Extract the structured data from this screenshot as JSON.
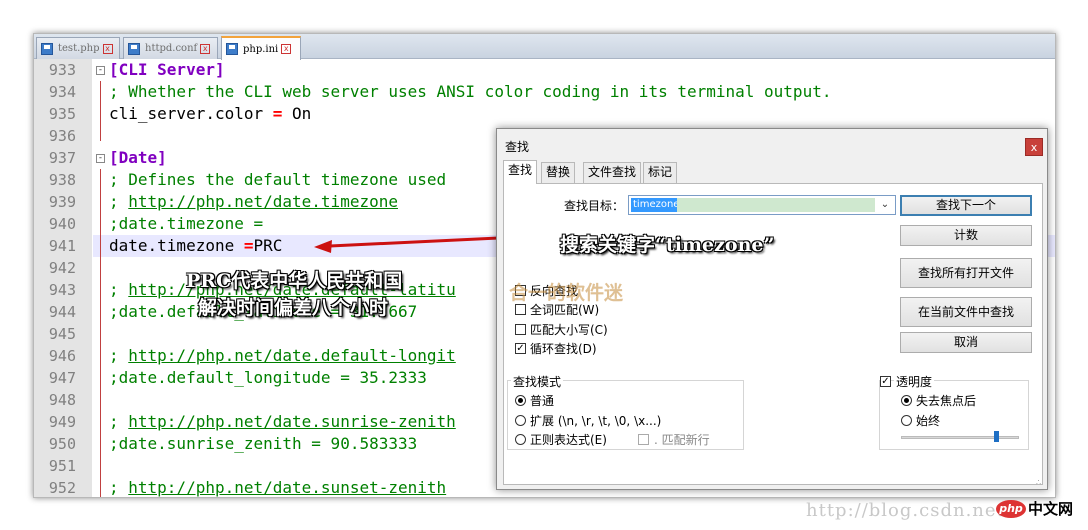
{
  "tabs": [
    {
      "label": "test.php",
      "active": false
    },
    {
      "label": "httpd.conf",
      "active": false
    },
    {
      "label": "php.ini",
      "active": true
    }
  ],
  "editor": {
    "lines": [
      {
        "num": "933",
        "parts": [
          {
            "t": "[CLI Server]",
            "c": "section"
          }
        ]
      },
      {
        "num": "934",
        "parts": [
          {
            "t": "; Whether the CLI web server uses ANSI color coding in its terminal output.",
            "c": "comment"
          }
        ]
      },
      {
        "num": "935",
        "parts": [
          {
            "t": "cli_server.color ",
            "c": "plain"
          },
          {
            "t": "=",
            "c": "op"
          },
          {
            "t": " On",
            "c": "plain"
          }
        ]
      },
      {
        "num": "936",
        "parts": []
      },
      {
        "num": "937",
        "parts": [
          {
            "t": "[Date]",
            "c": "section"
          }
        ]
      },
      {
        "num": "938",
        "parts": [
          {
            "t": "; Defines the default timezone used",
            "c": "comment"
          }
        ]
      },
      {
        "num": "939",
        "parts": [
          {
            "t": "; ",
            "c": "comment"
          },
          {
            "t": "http://php.net/date.timezone",
            "c": "link"
          }
        ]
      },
      {
        "num": "940",
        "parts": [
          {
            "t": ";date.timezone =",
            "c": "comment"
          }
        ]
      },
      {
        "num": "941",
        "parts": [
          {
            "t": "date.timezone ",
            "c": "plain"
          },
          {
            "t": "=",
            "c": "op"
          },
          {
            "t": "PRC",
            "c": "plain"
          }
        ]
      },
      {
        "num": "942",
        "parts": []
      },
      {
        "num": "943",
        "parts": [
          {
            "t": "; ",
            "c": "comment"
          },
          {
            "t": "http://php.net/date.default-latitu",
            "c": "link"
          }
        ]
      },
      {
        "num": "944",
        "parts": [
          {
            "t": ";date.default_latitude = 31.7667",
            "c": "comment"
          }
        ]
      },
      {
        "num": "945",
        "parts": []
      },
      {
        "num": "946",
        "parts": [
          {
            "t": "; ",
            "c": "comment"
          },
          {
            "t": "http://php.net/date.default-longit",
            "c": "link"
          }
        ]
      },
      {
        "num": "947",
        "parts": [
          {
            "t": ";date.default_longitude = 35.2333",
            "c": "comment"
          }
        ]
      },
      {
        "num": "948",
        "parts": []
      },
      {
        "num": "949",
        "parts": [
          {
            "t": "; ",
            "c": "comment"
          },
          {
            "t": "http://php.net/date.sunrise-zenith",
            "c": "link"
          }
        ]
      },
      {
        "num": "950",
        "parts": [
          {
            "t": ";date.sunrise_zenith = 90.583333",
            "c": "comment"
          }
        ]
      },
      {
        "num": "951",
        "parts": []
      },
      {
        "num": "952",
        "parts": [
          {
            "t": "; ",
            "c": "comment"
          },
          {
            "t": "http://php.net/date.sunset-zenith",
            "c": "link"
          }
        ]
      }
    ],
    "fold_markers": [
      "933",
      "937"
    ]
  },
  "annotations": {
    "keyword": "搜索关键字“timezone”",
    "prc_line1": "PRC代表中华人民共和国",
    "prc_line2": "解决时间偏差八个小时"
  },
  "find_dialog": {
    "title": "查找",
    "close_icon": "close-icon",
    "tabs": [
      "查找",
      "替换",
      "文件查找",
      "标记"
    ],
    "active_tab": "查找",
    "target_label": "查找目标：",
    "target_value": "timezone",
    "buttons": {
      "find_next": "查找下一个",
      "count": "计数",
      "find_all_open": "查找所有打开文件",
      "find_in_current": "在当前文件中查找",
      "cancel": "取消"
    },
    "options": [
      {
        "label": "反向查找",
        "checked": false
      },
      {
        "label": "全词匹配(W)",
        "checked": false
      },
      {
        "label": "匹配大小写(C)",
        "checked": false
      },
      {
        "label": "循环查找(D)",
        "checked": true
      }
    ],
    "search_mode": {
      "title": "查找模式",
      "normal": "普通",
      "extended": "扩展 (\\n, \\r, \\t, \\0, \\x...)",
      "regex": "正则表达式(E)",
      "dot_newline": ". 匹配新行",
      "selected": "普通"
    },
    "transparency": {
      "title": "透明度",
      "checked": true,
      "on_lose_focus": "失去焦点后",
      "always": "始终",
      "selected": "失去焦点后",
      "level": 0.82
    }
  },
  "watermark": "合一的软件迷",
  "footer": {
    "url": "http://blog.csdn.net",
    "logo": "php",
    "site": "中文网"
  },
  "colors": {
    "section": "#8000c0",
    "comment": "#008000",
    "operator": "#ff0000",
    "arrow": "#cc1111",
    "tab_accent": "#f3a33b"
  }
}
